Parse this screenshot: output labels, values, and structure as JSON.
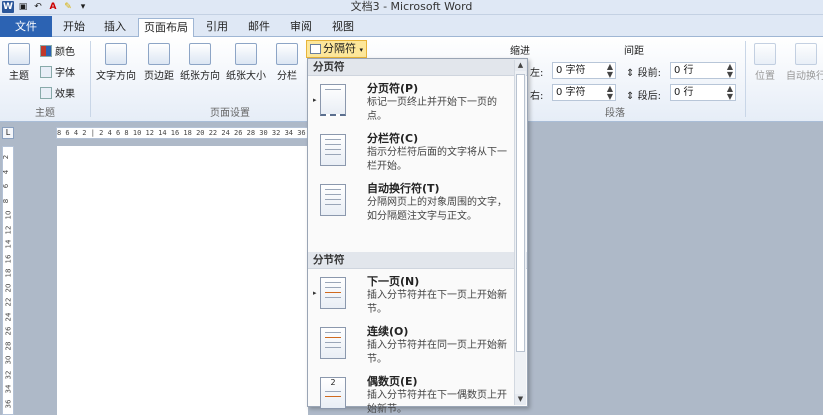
{
  "window": {
    "title": "文档3 - Microsoft Word"
  },
  "tabs": [
    {
      "label": "文件"
    },
    {
      "label": "开始"
    },
    {
      "label": "插入"
    },
    {
      "label": "页面布局"
    },
    {
      "label": "引用"
    },
    {
      "label": "邮件"
    },
    {
      "label": "审阅"
    },
    {
      "label": "视图"
    }
  ],
  "ribbon": {
    "theme_group": {
      "theme_label": "主题",
      "colors_label": "颜色",
      "fonts_label": "字体",
      "effects_label": "效果",
      "group_label": "主题"
    },
    "page_setup": {
      "text_direction": "文字方向",
      "margins": "页边距",
      "orientation": "纸张方向",
      "size": "纸张大小",
      "columns": "分栏",
      "breaks": "分隔符",
      "group_label": "页面设置"
    },
    "paragraph": {
      "indent_label": "缩进",
      "spacing_label": "间距",
      "left_label": "左:",
      "left_value": "0 字符",
      "right_label": "右:",
      "right_value": "0 字符",
      "before_label": "段前:",
      "before_value": "0 行",
      "after_label": "段后:",
      "after_value": "0 行",
      "group_label": "段落"
    },
    "arrange": {
      "position": "位置",
      "wrap": "自动换行"
    }
  },
  "ruler_text": "8 6 4 2 | 2 4 6 8 10 12 14 16 18 20 22 24 26 28 30 32 34 36 38",
  "vruler_ticks": [
    "2",
    "4",
    "6",
    "8",
    "10",
    "12",
    "14",
    "16",
    "18",
    "20",
    "22",
    "24",
    "26",
    "28",
    "30",
    "32",
    "34",
    "36"
  ],
  "menu": {
    "section_page": "分页符",
    "section_section": "分节符",
    "items": [
      {
        "title": "分页符(P)",
        "desc": "标记一页终止并开始下一页的点。"
      },
      {
        "title": "分栏符(C)",
        "desc": "指示分栏符后面的文字将从下一栏开始。"
      },
      {
        "title": "自动换行符(T)",
        "desc": "分隔网页上的对象周围的文字，如分隔题注文字与正文。"
      },
      {
        "title": "下一页(N)",
        "desc": "插入分节符并在下一页上开始新节。"
      },
      {
        "title": "连续(O)",
        "desc": "插入分节符并在同一页上开始新节。"
      },
      {
        "title": "偶数页(E)",
        "desc": "插入分节符并在下一偶数页上开始新节。"
      }
    ]
  },
  "colors": {
    "file_tab": "#2c63b3",
    "breaks_highlight": "#fde79a",
    "doc_background": "#aeb9c8"
  }
}
